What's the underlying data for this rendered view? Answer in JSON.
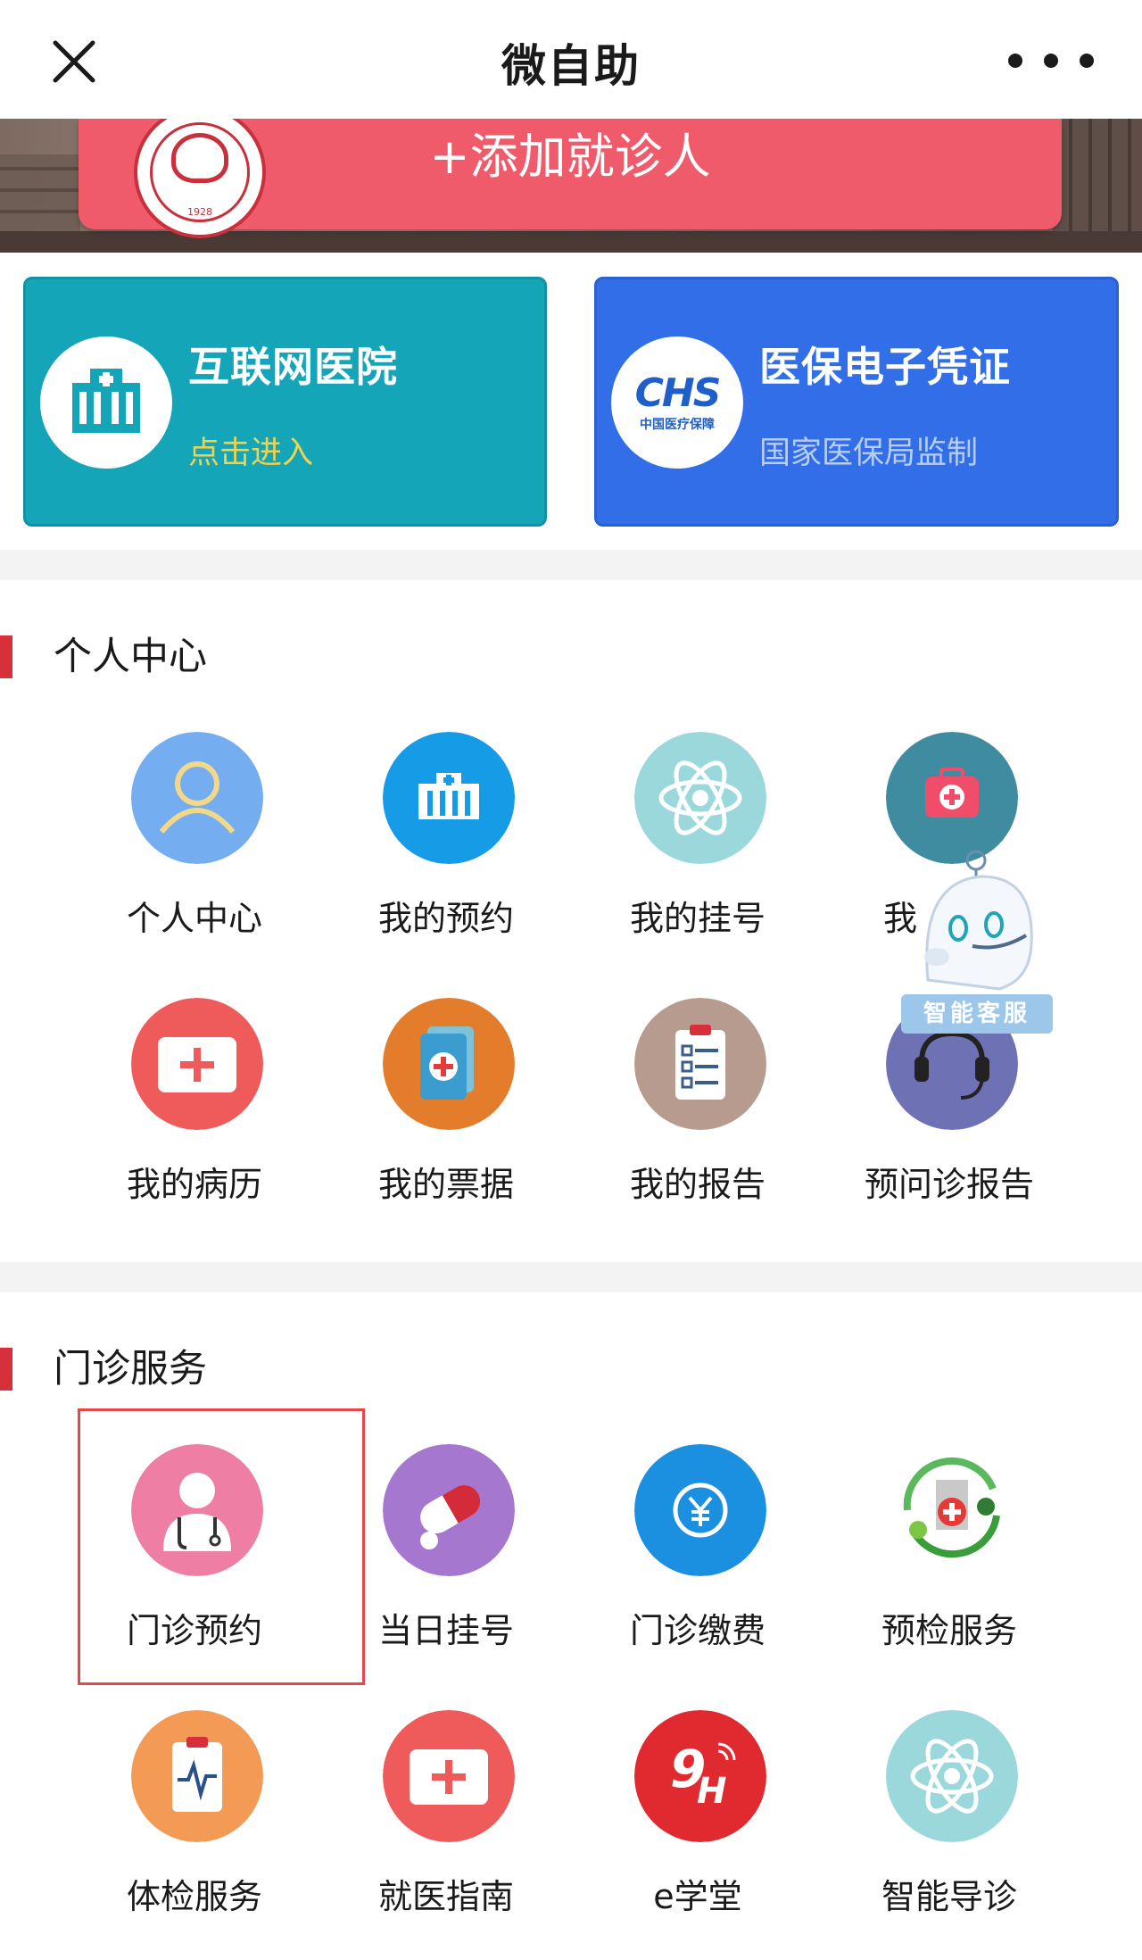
{
  "nav": {
    "title": "微自助",
    "close_icon": "close-icon",
    "more_icon": "more-dots-icon"
  },
  "banner": {
    "add_patient_label": "+添加就诊人",
    "hospital_logo_year": "1928"
  },
  "cards": {
    "internet_hospital": {
      "title": "互联网医院",
      "subtitle": "点击进入",
      "icon": "hospital-building-icon"
    },
    "medical_insurance": {
      "title": "医保电子凭证",
      "subtitle": "国家医保局监制",
      "logo_text": "CHS",
      "logo_cn": "中国医疗保障"
    }
  },
  "personal": {
    "title": "个人中心",
    "items": [
      {
        "label": "个人中心"
      },
      {
        "label": "我的预约"
      },
      {
        "label": "我的挂号"
      },
      {
        "label": "我"
      },
      {
        "label": "我的病历"
      },
      {
        "label": "我的票据"
      },
      {
        "label": "我的报告"
      },
      {
        "label": "预问诊报告"
      }
    ]
  },
  "outpatient": {
    "title": "门诊服务",
    "items": [
      {
        "label": "门诊预约"
      },
      {
        "label": "当日挂号"
      },
      {
        "label": "门诊缴费"
      },
      {
        "label": "预检服务"
      },
      {
        "label": "体检服务"
      },
      {
        "label": "就医指南"
      },
      {
        "label": "e学堂"
      },
      {
        "label": "智能导诊"
      }
    ]
  },
  "assistant": {
    "label": "智能客服"
  },
  "colors": {
    "accent_red": "#d8303a",
    "teal_card": "#14a6b8",
    "blue_card": "#316ee8",
    "add_patient": "#ef5b6a"
  }
}
